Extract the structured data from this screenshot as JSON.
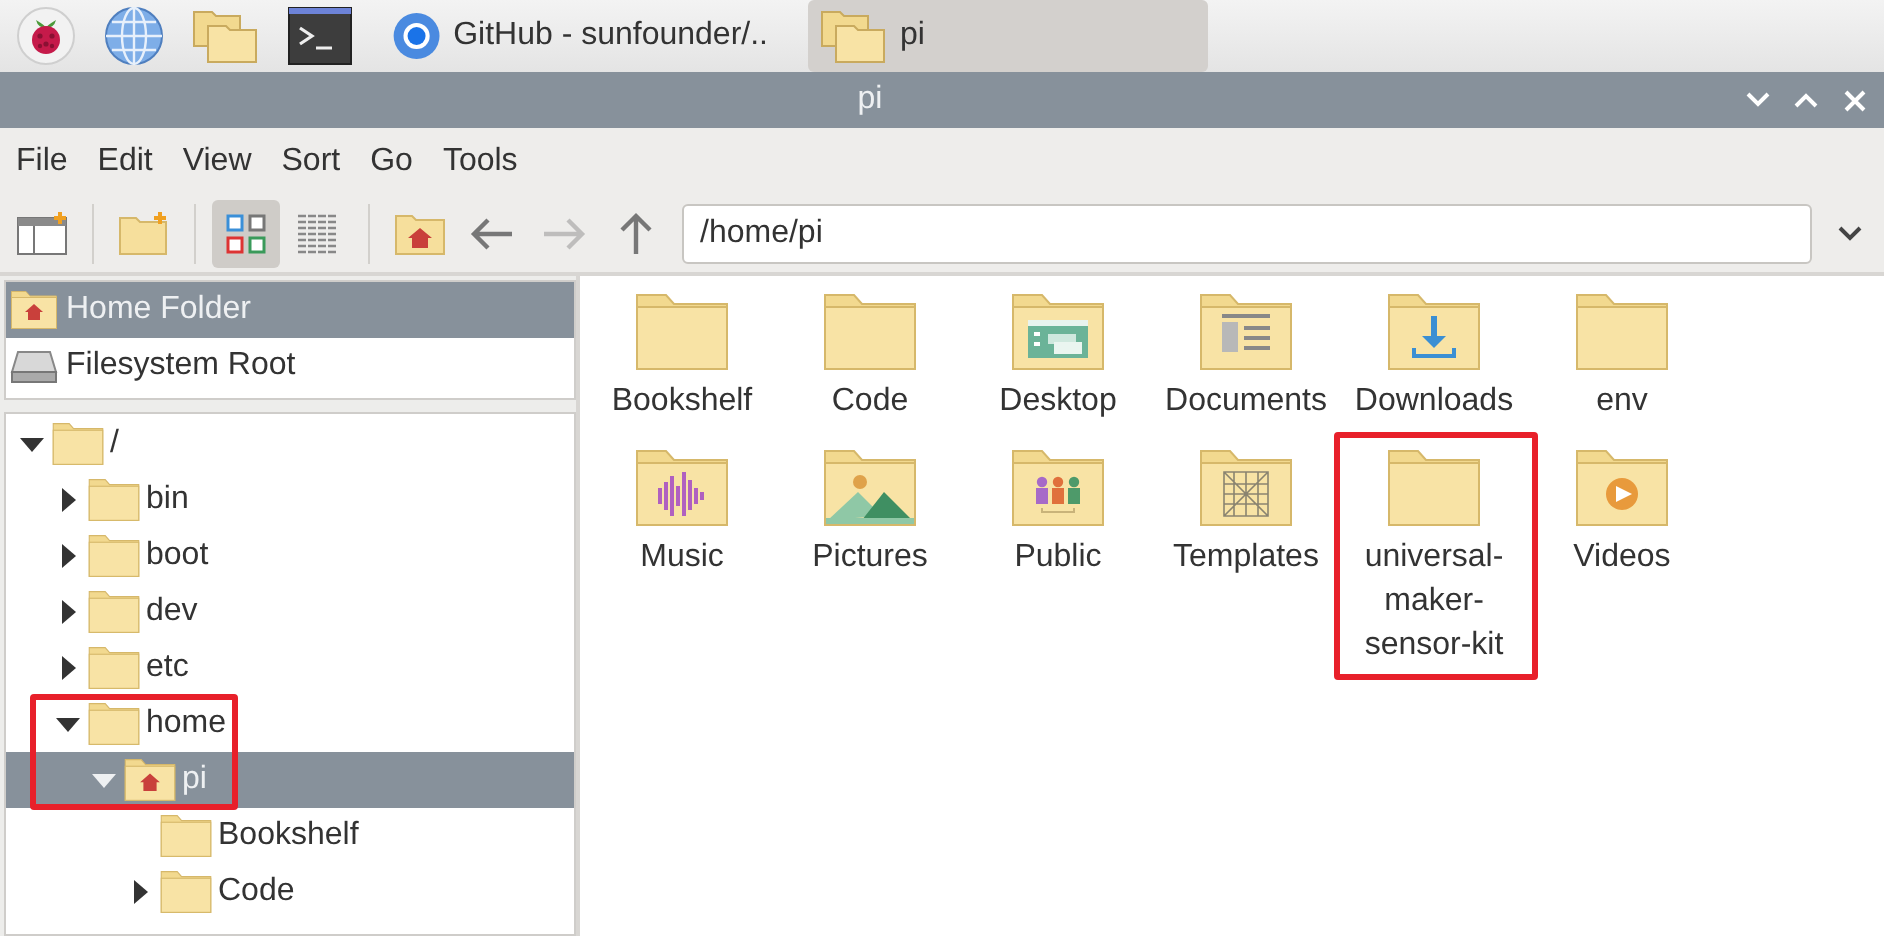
{
  "taskbar": {
    "launchers": [
      {
        "kind": "raspberry"
      },
      {
        "kind": "globe"
      },
      {
        "kind": "files"
      },
      {
        "kind": "terminal"
      }
    ],
    "tasks": [
      {
        "label": "GitHub - sunfounder/..",
        "kind": "browser",
        "selected": false
      },
      {
        "label": "pi",
        "kind": "folder",
        "selected": true
      }
    ]
  },
  "window": {
    "title": "pi"
  },
  "menu": [
    "File",
    "Edit",
    "View",
    "Sort",
    "Go",
    "Tools"
  ],
  "toolbar": {
    "buttons": [
      {
        "kind": "sidebar-toggle"
      },
      {
        "kind": "new-folder"
      },
      {
        "kind": "icon-view",
        "selected": true
      },
      {
        "kind": "list-view",
        "selected": false
      },
      {
        "kind": "home"
      },
      {
        "kind": "back",
        "disabled": false
      },
      {
        "kind": "forward",
        "disabled": true
      },
      {
        "kind": "up",
        "disabled": false
      }
    ],
    "path": "/home/pi"
  },
  "places": [
    {
      "label": "Home Folder",
      "kind": "home",
      "selected": true
    },
    {
      "label": "Filesystem Root",
      "kind": "drive",
      "selected": false
    }
  ],
  "tree": [
    {
      "label": "/",
      "kind": "folder",
      "has_children": true,
      "expanded": true,
      "selected": false,
      "highlighted": false,
      "children": [
        {
          "label": "bin",
          "kind": "folder",
          "has_children": true,
          "expanded": false,
          "selected": false,
          "highlighted": false
        },
        {
          "label": "boot",
          "kind": "folder",
          "has_children": true,
          "expanded": false,
          "selected": false,
          "highlighted": false
        },
        {
          "label": "dev",
          "kind": "folder",
          "has_children": true,
          "expanded": false,
          "selected": false,
          "highlighted": false
        },
        {
          "label": "etc",
          "kind": "folder",
          "has_children": true,
          "expanded": false,
          "selected": false,
          "highlighted": false
        },
        {
          "label": "home",
          "kind": "folder",
          "has_children": true,
          "expanded": true,
          "selected": false,
          "highlighted": true,
          "children": [
            {
              "label": "pi",
              "kind": "home",
              "has_children": true,
              "expanded": true,
              "selected": true,
              "highlighted": true,
              "children": [
                {
                  "label": "Bookshelf",
                  "kind": "folder",
                  "has_children": false,
                  "selected": false,
                  "highlighted": false
                },
                {
                  "label": "Code",
                  "kind": "folder",
                  "has_children": true,
                  "expanded": false,
                  "selected": false,
                  "highlighted": false
                }
              ]
            }
          ]
        }
      ]
    }
  ],
  "files": [
    {
      "label": "Bookshelf",
      "kind": "folder",
      "highlighted": false
    },
    {
      "label": "Code",
      "kind": "folder",
      "highlighted": false
    },
    {
      "label": "Desktop",
      "kind": "desktop",
      "highlighted": false
    },
    {
      "label": "Documents",
      "kind": "documents",
      "highlighted": false
    },
    {
      "label": "Downloads",
      "kind": "downloads",
      "highlighted": false
    },
    {
      "label": "env",
      "kind": "folder",
      "highlighted": false
    },
    {
      "label": "Music",
      "kind": "music",
      "highlighted": false
    },
    {
      "label": "Pictures",
      "kind": "pictures",
      "highlighted": false
    },
    {
      "label": "Public",
      "kind": "public",
      "highlighted": false
    },
    {
      "label": "Templates",
      "kind": "templates",
      "highlighted": false
    },
    {
      "label": "universal-maker-sensor-kit",
      "kind": "folder",
      "highlighted": true
    },
    {
      "label": "Videos",
      "kind": "videos",
      "highlighted": false
    }
  ]
}
